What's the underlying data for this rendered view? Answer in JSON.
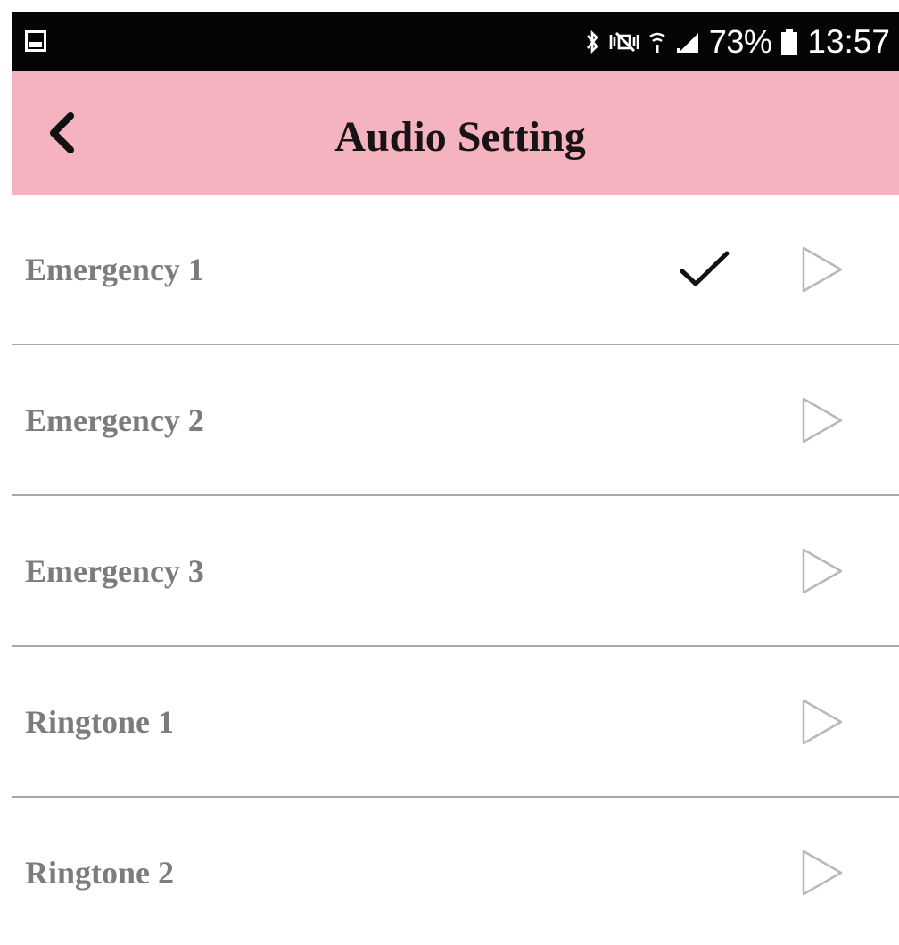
{
  "status_bar": {
    "battery_percent": "73%",
    "time": "13:57",
    "icons": [
      "image-notification-icon",
      "bluetooth-icon",
      "mute-vibrate-icon",
      "wifi-icon",
      "signal-icon",
      "battery-icon"
    ]
  },
  "header": {
    "title": "Audio Setting",
    "back_icon": "chevron-left-icon",
    "background": "#f5b3c0"
  },
  "audio_items": [
    {
      "label": "Emergency 1",
      "selected": true
    },
    {
      "label": "Emergency 2",
      "selected": false
    },
    {
      "label": "Emergency 3",
      "selected": false
    },
    {
      "label": "Ringtone 1",
      "selected": false
    },
    {
      "label": "Ringtone 2",
      "selected": false
    }
  ],
  "colors": {
    "label": "#7c7c7c",
    "divider": "#a8a8a8",
    "play_icon": "#b8b8b8",
    "check_icon": "#111111"
  }
}
